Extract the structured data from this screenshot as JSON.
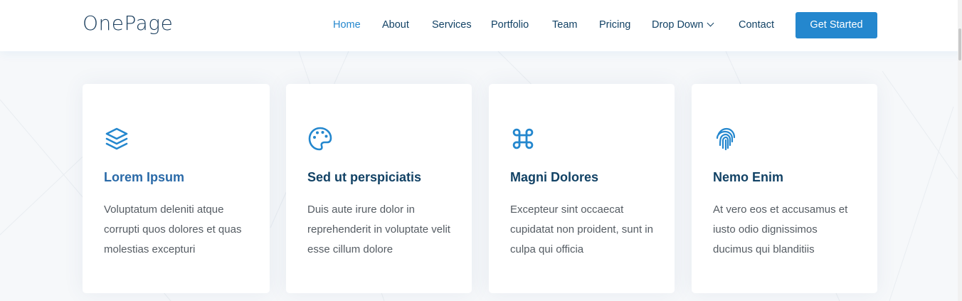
{
  "header": {
    "logo": "OnePage",
    "nav": [
      {
        "label": "Home",
        "active": true
      },
      {
        "label": "About"
      },
      {
        "label": "Services"
      },
      {
        "label": "Portfolio"
      },
      {
        "label": "Team"
      },
      {
        "label": "Pricing"
      },
      {
        "label": "Drop Down",
        "dropdown": true
      },
      {
        "label": "Contact"
      }
    ],
    "cta_label": "Get Started"
  },
  "services": [
    {
      "icon": "layers-icon",
      "title": "Lorem Ipsum",
      "text": "Voluptatum deleniti atque corrupti quos dolores et quas molestias excepturi"
    },
    {
      "icon": "palette-icon",
      "title": "Sed ut perspiciatis",
      "text": "Duis aute irure dolor in reprehenderit in voluptate velit esse cillum dolore"
    },
    {
      "icon": "command-icon",
      "title": "Magni Dolores",
      "text": "Excepteur sint occaecat cupidatat non proident, sunt in culpa qui officia"
    },
    {
      "icon": "fingerprint-icon",
      "title": "Nemo Enim",
      "text": "At vero eos et accusamus et iusto odio dignissimos ducimus qui blanditiis"
    }
  ],
  "colors": {
    "accent": "#2487ce",
    "heading": "#124265",
    "text": "#555c63"
  }
}
